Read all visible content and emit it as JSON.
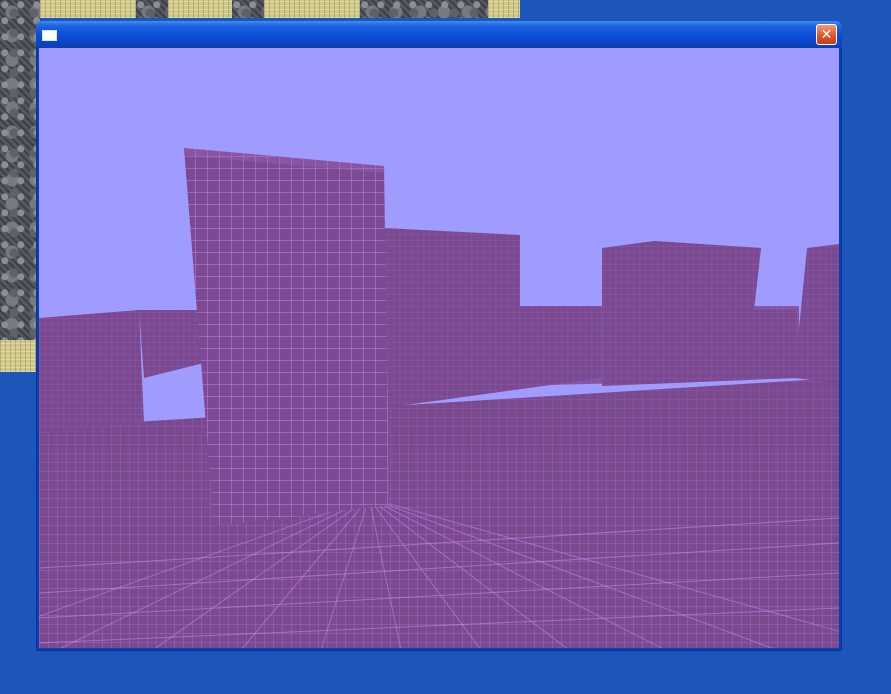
{
  "window": {
    "title": "",
    "close_symbol": "✕",
    "icon": "app-icon"
  },
  "scene": {
    "sky_color": "#a09cff",
    "floor_color": "#7a4a8f",
    "wall_color": "#7c4a92",
    "grid_color": "#d07ff0"
  },
  "desktop": {
    "background_color": "#1b56b8"
  }
}
